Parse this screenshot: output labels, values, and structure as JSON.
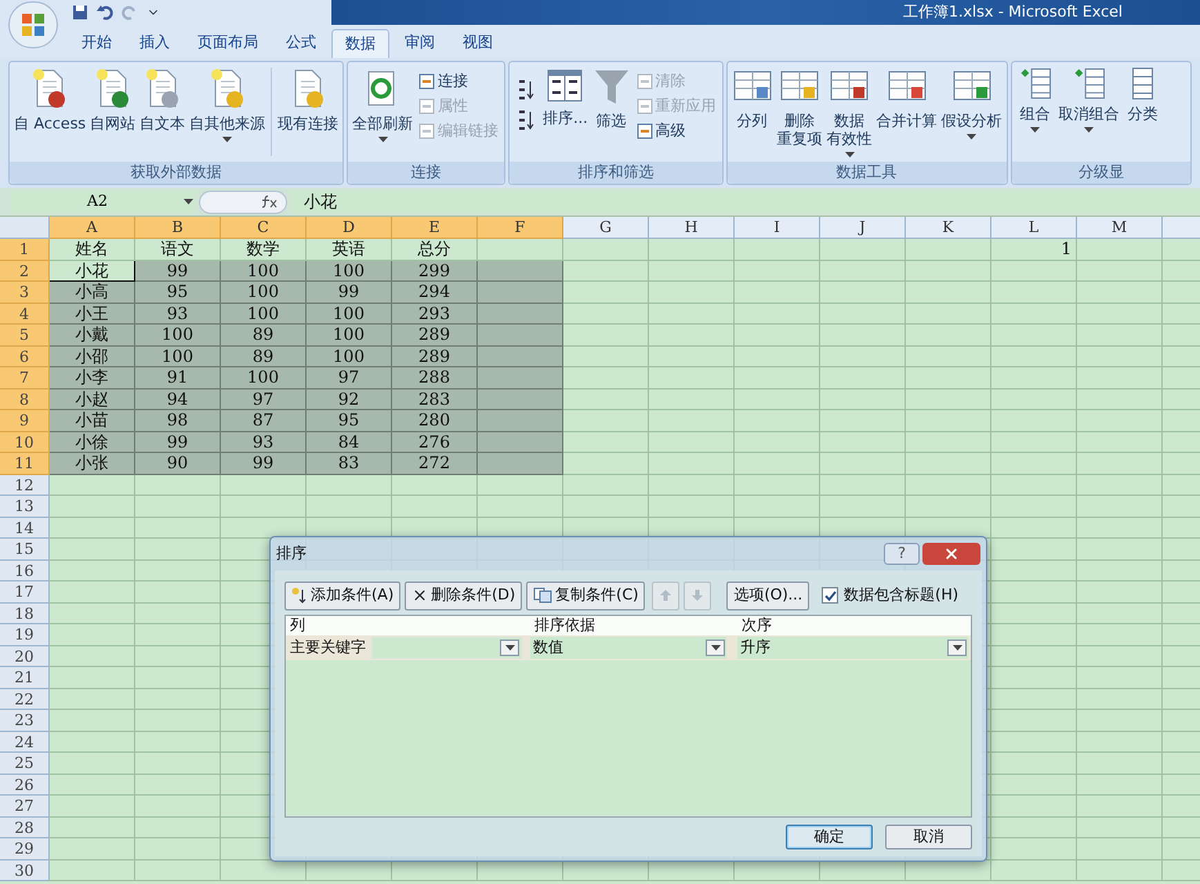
{
  "window": {
    "title": "工作簿1.xlsx - Microsoft Excel"
  },
  "tabs": [
    {
      "label": "开始",
      "selected": false
    },
    {
      "label": "插入",
      "selected": false
    },
    {
      "label": "页面布局",
      "selected": false
    },
    {
      "label": "公式",
      "selected": false
    },
    {
      "label": "数据",
      "selected": true
    },
    {
      "label": "审阅",
      "selected": false
    },
    {
      "label": "视图",
      "selected": false
    }
  ],
  "ribbon": [
    {
      "label": "获取外部数据",
      "buttons": [
        {
          "kind": "large",
          "label": "自 Access",
          "dropdown": false,
          "disabled": false
        },
        {
          "kind": "large",
          "label": "自网站",
          "dropdown": false,
          "disabled": false
        },
        {
          "kind": "large",
          "label": "自文本",
          "dropdown": false,
          "disabled": false
        },
        {
          "kind": "large",
          "label": "自其他来源",
          "dropdown": true,
          "disabled": false
        },
        {
          "kind": "separator"
        },
        {
          "kind": "large",
          "label": "现有连接",
          "dropdown": false,
          "disabled": false
        }
      ]
    },
    {
      "label": "连接",
      "buttons": [
        {
          "kind": "large",
          "label": "全部刷新",
          "dropdown": true,
          "disabled": false
        },
        {
          "kind": "small",
          "label": "连接",
          "disabled": false
        },
        {
          "kind": "small",
          "label": "属性",
          "disabled": true
        },
        {
          "kind": "small",
          "label": "编辑链接",
          "disabled": true
        }
      ]
    },
    {
      "label": "排序和筛选",
      "buttons": [
        {
          "kind": "sortpair"
        },
        {
          "kind": "large",
          "label": "排序...",
          "dropdown": false,
          "disabled": false
        },
        {
          "kind": "large",
          "label": "筛选",
          "dropdown": false,
          "disabled": false
        },
        {
          "kind": "small",
          "label": "清除",
          "disabled": true
        },
        {
          "kind": "small",
          "label": "重新应用",
          "disabled": true
        },
        {
          "kind": "small",
          "label": "高级",
          "disabled": false
        }
      ]
    },
    {
      "label": "数据工具",
      "buttons": [
        {
          "kind": "large",
          "label": "分列",
          "dropdown": false,
          "disabled": false
        },
        {
          "kind": "large",
          "label": [
            "删除",
            "重复项"
          ],
          "dropdown": false,
          "disabled": false
        },
        {
          "kind": "large",
          "label": [
            "数据",
            "有效性"
          ],
          "dropdown": true,
          "disabled": false
        },
        {
          "kind": "large",
          "label": "合并计算",
          "dropdown": false,
          "disabled": false
        },
        {
          "kind": "large",
          "label": "假设分析",
          "dropdown": true,
          "disabled": false
        }
      ]
    },
    {
      "label": "分级显",
      "buttons": [
        {
          "kind": "large",
          "label": "组合",
          "dropdown": true,
          "disabled": false
        },
        {
          "kind": "large",
          "label": "取消组合",
          "dropdown": true,
          "disabled": false
        },
        {
          "kind": "large",
          "label": "分类",
          "dropdown": false,
          "disabled": false
        }
      ]
    }
  ],
  "formula_bar": {
    "name_box": "A2",
    "formula": "小花"
  },
  "columns": [
    {
      "label": "A",
      "selected": true
    },
    {
      "label": "B",
      "selected": true
    },
    {
      "label": "C",
      "selected": true
    },
    {
      "label": "D",
      "selected": true
    },
    {
      "label": "E",
      "selected": true
    },
    {
      "label": "F",
      "selected": true
    },
    {
      "label": "G",
      "selected": false
    },
    {
      "label": "H",
      "selected": false
    },
    {
      "label": "I",
      "selected": false
    },
    {
      "label": "J",
      "selected": false
    },
    {
      "label": "K",
      "selected": false
    },
    {
      "label": "L",
      "selected": false
    },
    {
      "label": "M",
      "selected": false
    }
  ],
  "rows": [
    {
      "number": "1",
      "highlighted": true,
      "selected": false,
      "active": false,
      "cells": [
        "姓名",
        "语文",
        "数学",
        "英语",
        "总分",
        null,
        null,
        null,
        null,
        null,
        null,
        "1"
      ]
    },
    {
      "number": "2",
      "highlighted": true,
      "selected": true,
      "active": true,
      "cells": [
        "小花",
        "99",
        "100",
        "100",
        "299"
      ]
    },
    {
      "number": "3",
      "highlighted": true,
      "selected": true,
      "active": false,
      "cells": [
        "小高",
        "95",
        "100",
        "99",
        "294"
      ]
    },
    {
      "number": "4",
      "highlighted": true,
      "selected": true,
      "active": false,
      "cells": [
        "小王",
        "93",
        "100",
        "100",
        "293"
      ]
    },
    {
      "number": "5",
      "highlighted": true,
      "selected": true,
      "active": false,
      "cells": [
        "小戴",
        "100",
        "89",
        "100",
        "289"
      ]
    },
    {
      "number": "6",
      "highlighted": true,
      "selected": true,
      "active": false,
      "cells": [
        "小邵",
        "100",
        "89",
        "100",
        "289"
      ]
    },
    {
      "number": "7",
      "highlighted": true,
      "selected": true,
      "active": false,
      "cells": [
        "小李",
        "91",
        "100",
        "97",
        "288"
      ]
    },
    {
      "number": "8",
      "highlighted": true,
      "selected": true,
      "active": false,
      "cells": [
        "小赵",
        "94",
        "97",
        "92",
        "283"
      ]
    },
    {
      "number": "9",
      "highlighted": true,
      "selected": true,
      "active": false,
      "cells": [
        "小苗",
        "98",
        "87",
        "95",
        "280"
      ]
    },
    {
      "number": "10",
      "highlighted": true,
      "selected": true,
      "active": false,
      "cells": [
        "小徐",
        "99",
        "93",
        "84",
        "276"
      ]
    },
    {
      "number": "11",
      "highlighted": true,
      "selected": true,
      "active": false,
      "cells": [
        "小张",
        "90",
        "99",
        "83",
        "272"
      ]
    },
    {
      "number": "12",
      "highlighted": false,
      "selected": false,
      "active": false
    },
    {
      "number": "13",
      "highlighted": false,
      "selected": false,
      "active": false
    },
    {
      "number": "14",
      "highlighted": false,
      "selected": false,
      "active": false
    },
    {
      "number": "15",
      "highlighted": false,
      "selected": false,
      "active": false
    },
    {
      "number": "16",
      "highlighted": false,
      "selected": false,
      "active": false
    },
    {
      "number": "17",
      "highlighted": false,
      "selected": false,
      "active": false
    },
    {
      "number": "18",
      "highlighted": false,
      "selected": false,
      "active": false
    },
    {
      "number": "19",
      "highlighted": false,
      "selected": false,
      "active": false
    },
    {
      "number": "20",
      "highlighted": false,
      "selected": false,
      "active": false
    },
    {
      "number": "21",
      "highlighted": false,
      "selected": false,
      "active": false
    },
    {
      "number": "22",
      "highlighted": false,
      "selected": false,
      "active": false
    },
    {
      "number": "23",
      "highlighted": false,
      "selected": false,
      "active": false
    },
    {
      "number": "24",
      "highlighted": false,
      "selected": false,
      "active": false
    },
    {
      "number": "25",
      "highlighted": false,
      "selected": false,
      "active": false
    },
    {
      "number": "26",
      "highlighted": false,
      "selected": false,
      "active": false
    },
    {
      "number": "27",
      "highlighted": false,
      "selected": false,
      "active": false
    },
    {
      "number": "28",
      "highlighted": false,
      "selected": false,
      "active": false
    },
    {
      "number": "29",
      "highlighted": false,
      "selected": false,
      "active": false
    },
    {
      "number": "30",
      "highlighted": false,
      "selected": false,
      "active": false
    }
  ],
  "dialog": {
    "title": "排序",
    "help": "?",
    "toolbar": [
      {
        "kind": "add",
        "label": "添加条件(A)"
      },
      {
        "kind": "delete",
        "label": "删除条件(D)"
      },
      {
        "kind": "copy",
        "label": "复制条件(C)"
      },
      {
        "kind": "up",
        "disabled": true
      },
      {
        "kind": "down",
        "disabled": true
      },
      {
        "kind": "options",
        "label": "选项(O)..."
      }
    ],
    "header_checkbox": {
      "label": "数据包含标题(H)",
      "checked": true
    },
    "columns": [
      "列",
      "排序依据",
      "次序"
    ],
    "levels": [
      {
        "label": "主要关键字",
        "sort_on": "数值",
        "order": "升序"
      }
    ],
    "buttons": [
      {
        "label": "确定",
        "default": true
      },
      {
        "label": "取消",
        "default": false
      }
    ]
  }
}
